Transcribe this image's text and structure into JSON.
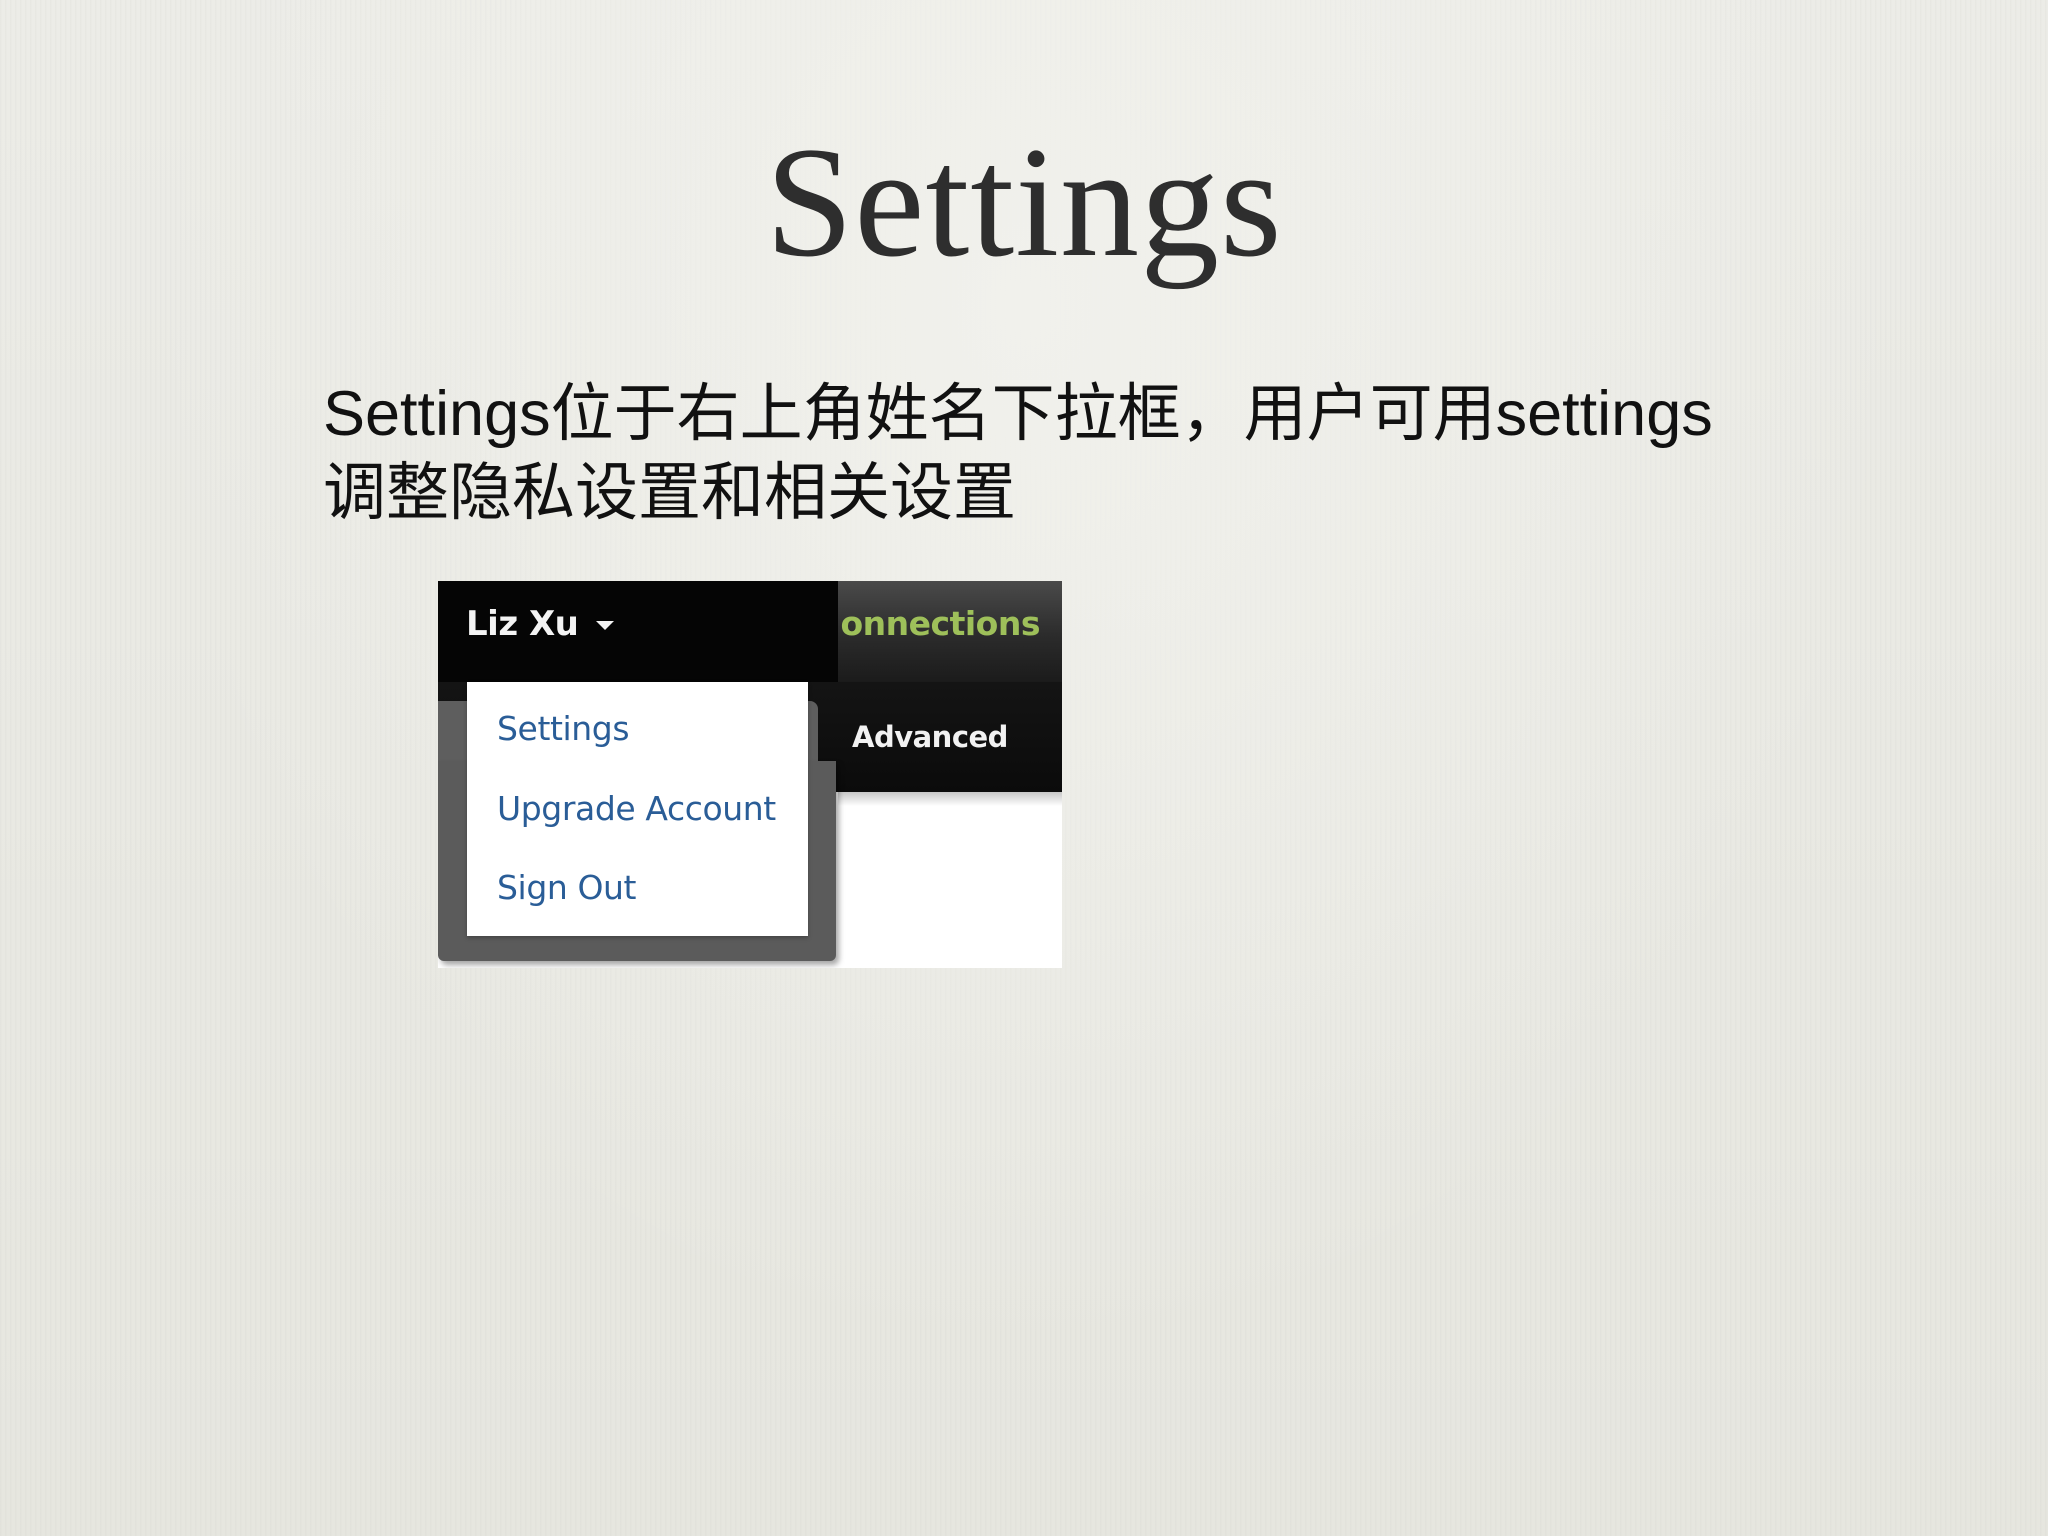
{
  "slide": {
    "title": "Settings",
    "body_lines": [
      "Settings位于右上角姓名下拉框，用户可用settings",
      "调整隐私设置和相关设置"
    ]
  },
  "screenshot": {
    "user_menu": {
      "name": "Liz Xu",
      "caret_icon": "chevron-down-icon"
    },
    "tabs": {
      "connections": "onnections",
      "advanced": "Advanced"
    },
    "dropdown": {
      "items": [
        {
          "label": "Settings"
        },
        {
          "label": "Upgrade Account"
        },
        {
          "label": "Sign Out"
        }
      ]
    },
    "colors": {
      "topbar": "#050505",
      "link": "#2a5d97",
      "connections_tab": "#9ec05a"
    }
  }
}
